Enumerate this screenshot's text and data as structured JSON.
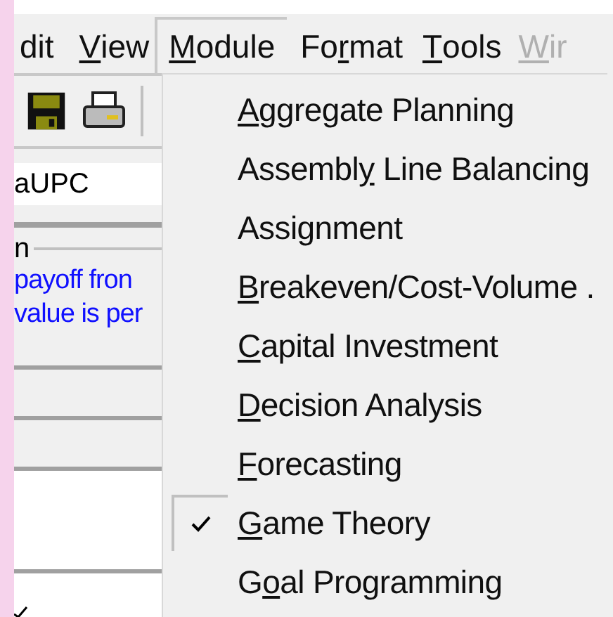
{
  "menu_bar": [
    {
      "label": [
        {
          "text": "dit",
          "underlined": false
        }
      ],
      "selected": false,
      "disabled": false
    },
    {
      "label": [
        {
          "text": "V",
          "underlined": true
        },
        {
          "text": "iew",
          "underlined": false
        }
      ],
      "selected": false,
      "disabled": false
    },
    {
      "label": [
        {
          "text": "M",
          "underlined": true
        },
        {
          "text": "odule",
          "underlined": false
        }
      ],
      "selected": true,
      "disabled": false
    },
    {
      "label": [
        {
          "text": "Fo",
          "underlined": false
        },
        {
          "text": "r",
          "underlined": true
        },
        {
          "text": "mat",
          "underlined": false
        }
      ],
      "selected": false,
      "disabled": false
    },
    {
      "label": [
        {
          "text": "T",
          "underlined": true
        },
        {
          "text": "ools",
          "underlined": false
        }
      ],
      "selected": false,
      "disabled": false
    },
    {
      "label": [
        {
          "text": "W",
          "underlined": true
        },
        {
          "text": "ir",
          "underlined": false
        }
      ],
      "selected": false,
      "disabled": true
    }
  ],
  "left_panel": {
    "field": {
      "value": "aUPC"
    },
    "group_label": "n",
    "description": [
      "payoff fron",
      "value is per"
    ]
  },
  "module_menu": [
    {
      "label": [
        {
          "text": "A",
          "underlined": true
        },
        {
          "text": "ggregate Planning",
          "underlined": false
        }
      ],
      "checked": false
    },
    {
      "label": [
        {
          "text": "Assembl",
          "underlined": false
        },
        {
          "text": "y",
          "underlined": true
        },
        {
          "text": " Line Balancing",
          "underlined": false
        }
      ],
      "checked": false
    },
    {
      "label": [
        {
          "text": "Assignment",
          "underlined": false
        }
      ],
      "checked": false
    },
    {
      "label": [
        {
          "text": "B",
          "underlined": true
        },
        {
          "text": "reakeven/Cost-Volume .",
          "underlined": false
        }
      ],
      "checked": false
    },
    {
      "label": [
        {
          "text": "C",
          "underlined": true
        },
        {
          "text": "apital Investment",
          "underlined": false
        }
      ],
      "checked": false
    },
    {
      "label": [
        {
          "text": "D",
          "underlined": true
        },
        {
          "text": "ecision Analysis",
          "underlined": false
        }
      ],
      "checked": false
    },
    {
      "label": [
        {
          "text": "F",
          "underlined": true
        },
        {
          "text": "orecasting",
          "underlined": false
        }
      ],
      "checked": false
    },
    {
      "label": [
        {
          "text": "G",
          "underlined": true
        },
        {
          "text": "ame Theory",
          "underlined": false
        }
      ],
      "checked": true
    },
    {
      "label": [
        {
          "text": "G",
          "underlined": false
        },
        {
          "text": "o",
          "underlined": true
        },
        {
          "text": "al Programming",
          "underlined": false
        }
      ],
      "checked": false
    }
  ]
}
